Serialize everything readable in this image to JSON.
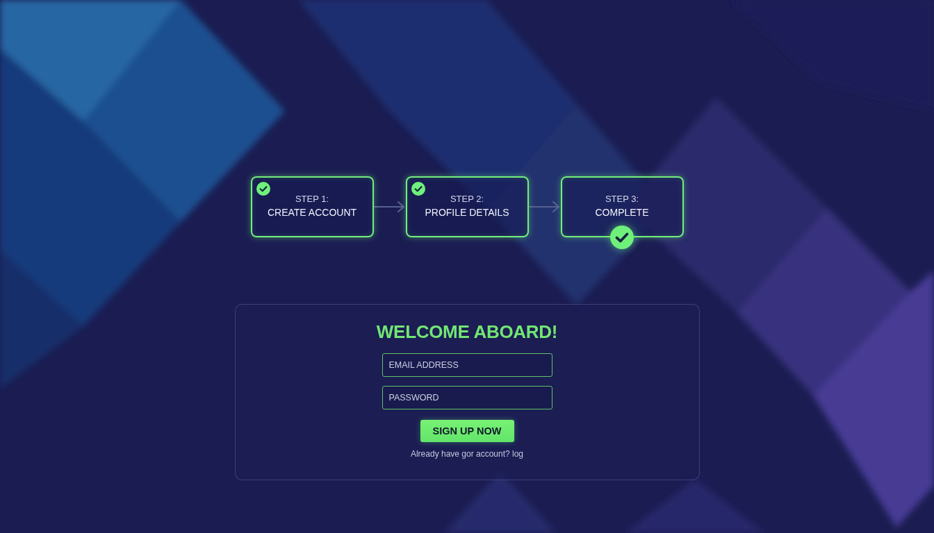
{
  "steps": [
    {
      "label": "STEP 1:",
      "title": "CREATE ACCOUNT",
      "completed": true,
      "kind": "step"
    },
    {
      "label": "STEP 2:",
      "title": "PROFILE DETAILS",
      "completed": true,
      "kind": "step"
    },
    {
      "label": "STEP 3:",
      "title": "COMPLETE",
      "completed": true,
      "kind": "final"
    }
  ],
  "signup_card": {
    "heading": "WELCOME ABOARD!",
    "fields": [
      {
        "placeholder": "EMAIL ADDRESS"
      },
      {
        "placeholder": "PASSWORD"
      }
    ],
    "submit_button": "SIGN UP NOW",
    "login_prompt": "Already have gor account? log"
  }
}
